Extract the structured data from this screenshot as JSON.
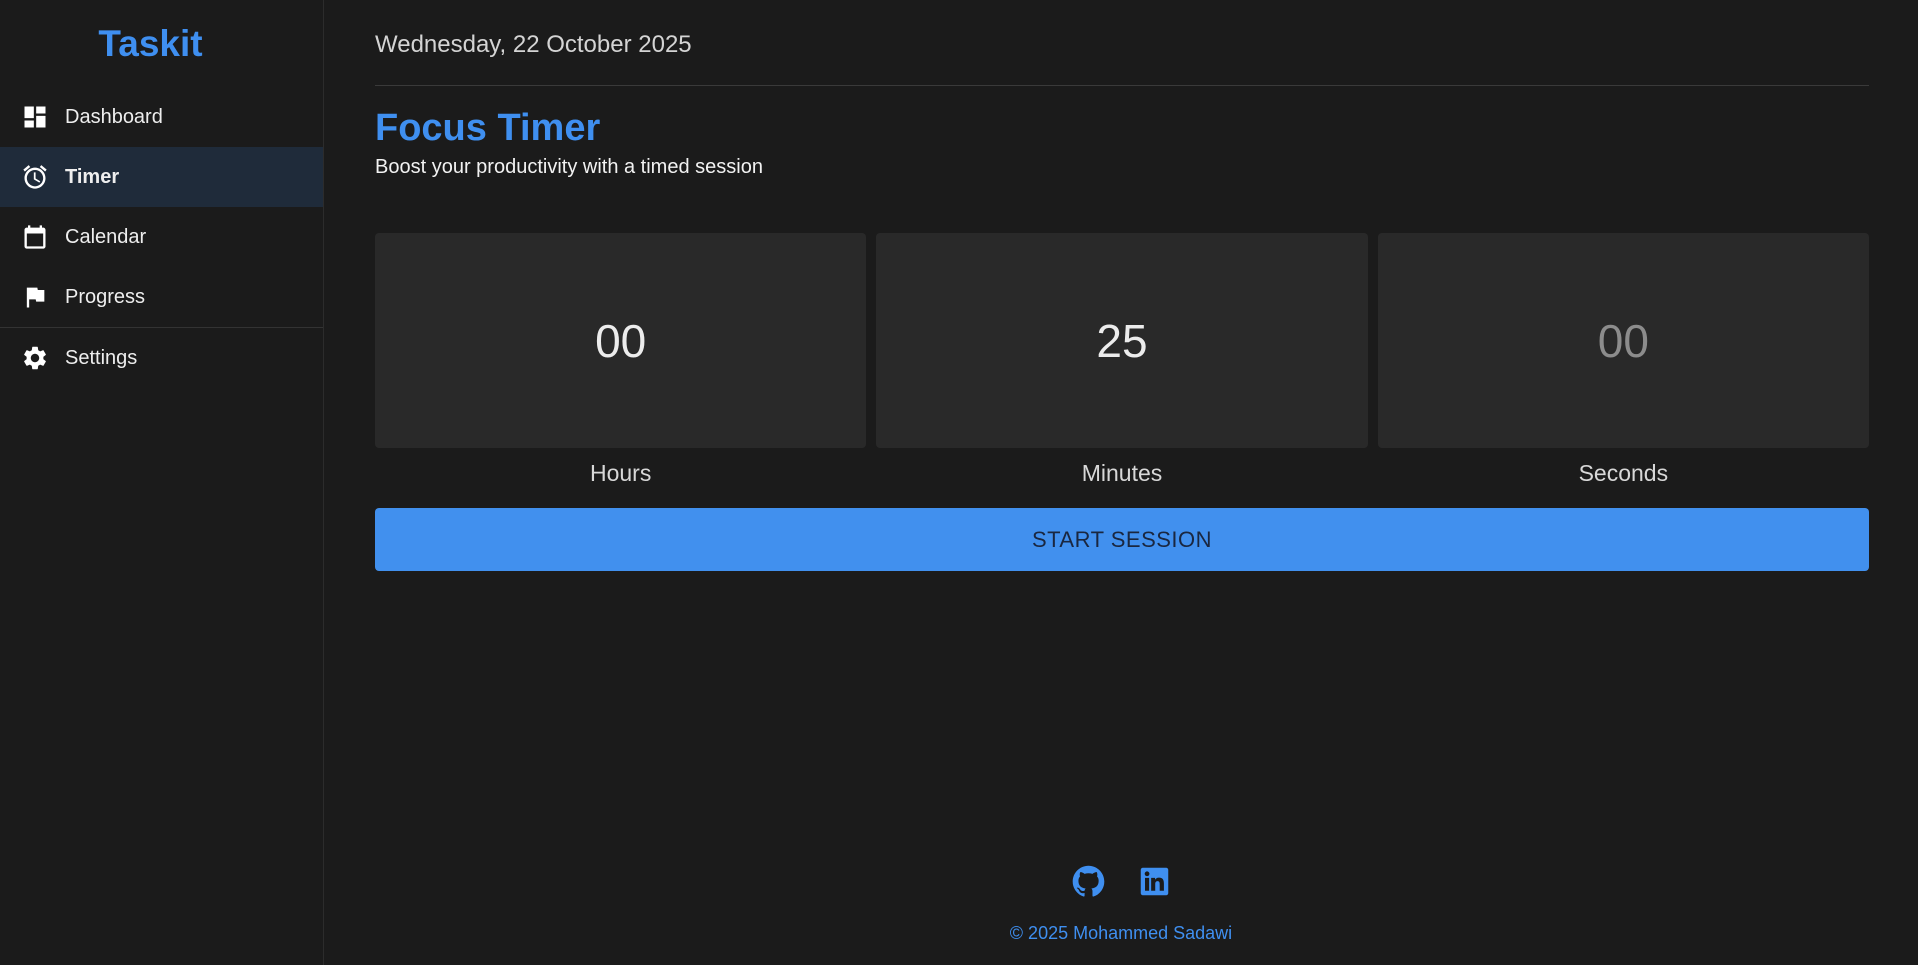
{
  "brand": {
    "name": "Taskit",
    "color": "#3f8ff0"
  },
  "sidebar": {
    "items": [
      {
        "label": "Dashboard",
        "icon": "dashboard-icon",
        "active": false
      },
      {
        "label": "Timer",
        "icon": "alarm-clock-icon",
        "active": true
      },
      {
        "label": "Calendar",
        "icon": "calendar-icon",
        "active": false
      },
      {
        "label": "Progress",
        "icon": "flag-icon",
        "active": false
      },
      {
        "label": "Settings",
        "icon": "gear-icon",
        "active": false
      }
    ]
  },
  "header": {
    "date": "Wednesday, 22 October 2025"
  },
  "main": {
    "title": "Focus Timer",
    "subtitle": "Boost your productivity with a timed session",
    "timer": {
      "hours": {
        "value": "00",
        "label": "Hours"
      },
      "minutes": {
        "value": "25",
        "label": "Minutes"
      },
      "seconds": {
        "value": "00",
        "label": "Seconds"
      }
    },
    "start_label": "START SESSION"
  },
  "footer": {
    "social": [
      "github-icon",
      "linkedin-icon"
    ],
    "copyright": "© 2025 Mohammed Sadawi"
  },
  "colors": {
    "accent": "#3f8ff0",
    "background": "#1b1b1b",
    "active_nav": "#1f2b3a",
    "timer_box": "#292929",
    "button": "#4190ee"
  }
}
